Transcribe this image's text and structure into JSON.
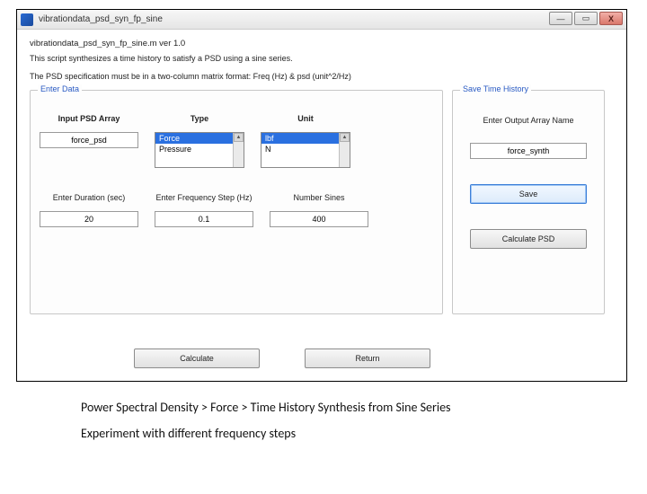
{
  "window": {
    "title": "vibrationdata_psd_syn_fp_sine"
  },
  "header": {
    "filename": "vibrationdata_psd_syn_fp_sine.m   ver 1.0",
    "desc1": "This script synthesizes a time history to satisfy a PSD using a sine series.",
    "desc2": "The PSD specification must be in a two-column matrix format:  Freq (Hz) & psd (unit^2/Hz)"
  },
  "enter_data": {
    "legend": "Enter Data",
    "input_psd_label": "Input PSD Array",
    "input_psd_value": "force_psd",
    "type_label": "Type",
    "type_options": [
      "Force",
      "Pressure"
    ],
    "type_selected": "Force",
    "unit_label": "Unit",
    "unit_options": [
      "lbf",
      "N"
    ],
    "unit_selected": "lbf",
    "duration_label": "Enter Duration (sec)",
    "duration_value": "20",
    "freqstep_label": "Enter Frequency Step (Hz)",
    "freqstep_value": "0.1",
    "numsines_label": "Number Sines",
    "numsines_value": "400"
  },
  "save": {
    "legend": "Save Time History",
    "out_label": "Enter Output Array Name",
    "out_value": "force_synth",
    "save_btn": "Save",
    "calc_psd_btn": "Calculate PSD"
  },
  "bottom": {
    "calculate": "Calculate",
    "return": "Return"
  },
  "captions": {
    "line1": "Power Spectral Density > Force > Time History Synthesis from Sine Series",
    "line2": "Experiment with different frequency steps"
  }
}
